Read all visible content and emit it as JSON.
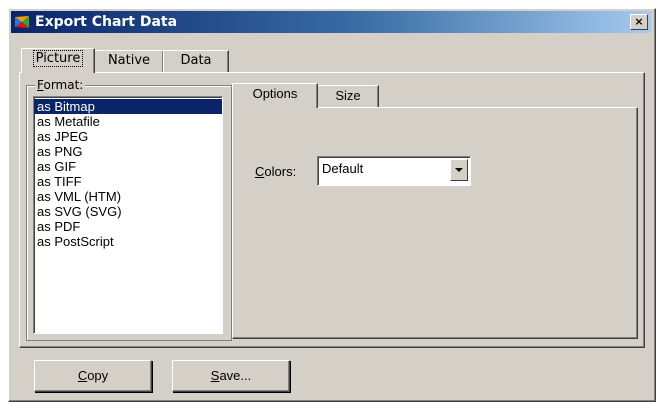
{
  "window": {
    "title": "Export Chart Data",
    "close_label": "×"
  },
  "tabs": [
    {
      "label": "Picture",
      "active": true
    },
    {
      "label": "Native",
      "active": false
    },
    {
      "label": "Data",
      "active": false
    }
  ],
  "format_group": {
    "legend_accel": "F",
    "legend_rest": "ormat:",
    "items": [
      "as Bitmap",
      "as Metafile",
      "as JPEG",
      "as PNG",
      "as GIF",
      "as TIFF",
      "as VML (HTM)",
      "as SVG (SVG)",
      "as PDF",
      "as PostScript"
    ],
    "selected_index": 0
  },
  "inner_tabs": [
    {
      "label": "Options",
      "active": true
    },
    {
      "label": "Size",
      "active": false
    }
  ],
  "colors_field": {
    "label_accel": "C",
    "label_rest": "olors:",
    "value": "Default"
  },
  "buttons": {
    "copy_accel": "C",
    "copy_rest": "opy",
    "save_accel": "S",
    "save_rest": "ave..."
  },
  "colors": {
    "face": "#d4d0c8",
    "title_start": "#0a246a",
    "title_end": "#a6caf0",
    "selection": "#0a246a"
  }
}
